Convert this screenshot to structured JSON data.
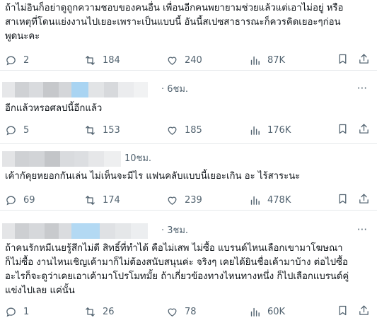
{
  "posts": [
    {
      "text": "ถ้าไม่อินก็อย่าดูถูกความชอบของคนอื่น เพื่อนอีกคนพยายามช่วยแล้วแต่เอาไม่อยู่ หรือ\nสาเหตุที่โดนแย่งงานไปเยอะเพราะเป็นแบบนี้ อันนี้สเปซสาธารณะก็ควรคิดเยอะๆก่อน\nพูดนะคะ",
      "replies": "2",
      "reposts": "184",
      "likes": "240",
      "views": "87K"
    },
    {
      "time": "· 6ชม.",
      "text": "อีกแล้วหรอศลปนี้อีกแล้ว",
      "replies": "5",
      "reposts": "153",
      "likes": "185",
      "views": "176K"
    },
    {
      "time": "10ชม.",
      "text": "เค้ากัคุยหยอกกันเล่น ไม่เห็นจะมีไร แฟนคลับแบบนี้เยอะเกิน อะ ไร้สาระนะ",
      "replies": "69",
      "reposts": "174",
      "likes": "239",
      "views": "478K"
    },
    {
      "time": "· 3ชม.",
      "text": "ถ้าคนรักหมีเนยรู้สึกไม่ดี สิทธิ์ที่ทำได้ คือไม่เสพ ไม่ซื้อ แบรนด์ไหนเลือกเขามาโฆษณา\nก็ไม่ซื้อ งานไหนเชิญเค้ามาก็ไม่ต้องสนับสนุนค่ะ จริงๆ เคยได้ยินชื่อเค้ามาบ้าง ต่อไปซื้อ\nอะไรก็จะดูว่าเคยเอาเค้ามาโปรโมทมั้ย ถ้าเกี่ยวข้องทางไหนทางหนึ่ง ก็ไปเลือกแบรนด์คู่\nแข่งไปเลย แค่นั้น",
      "replies": "1",
      "reposts": "26",
      "likes": "78",
      "views": "60K"
    }
  ],
  "more_label": "···",
  "colors": {
    "text": "#0f1419",
    "muted": "#536471",
    "divider": "#e6e9ec",
    "blur_gray": "#d9dbde",
    "blur_blue": "#a9d4f2"
  },
  "icons": {
    "reply": "comment-icon",
    "repost": "repost-icon",
    "like": "heart-icon",
    "views": "views-bar-chart-icon",
    "bookmark": "bookmark-icon",
    "share": "share-icon",
    "more": "more-dots-icon"
  }
}
